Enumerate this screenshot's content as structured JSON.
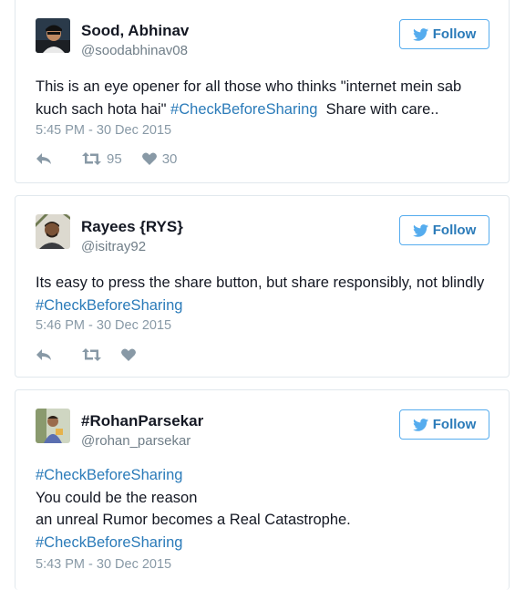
{
  "follow_label": "Follow",
  "colors": {
    "link": "#2b7bb9",
    "follow_border": "#55acee",
    "muted": "#8899a6"
  },
  "icons": {
    "follow": "twitter-bird-icon",
    "reply": "reply-icon",
    "retweet": "retweet-icon",
    "like": "heart-icon"
  },
  "tweets": [
    {
      "name": "Sood, Abhinav",
      "handle": "@soodabhinav08",
      "text_a": "This is an eye opener for all those who thinks \"internet mein sab kuch sach hota hai\" ",
      "hashtag_a": "#CheckBeforeSharing",
      "text_b": "  Share with care..",
      "timestamp": "5:45 PM - 30 Dec 2015",
      "retweets": "95",
      "likes": "30"
    },
    {
      "name": "Rayees {RYS}",
      "handle": "@isitray92",
      "text_a": "Its easy to press the share button, but share responsibly, not blindly ",
      "hashtag_a": "#CheckBeforeSharing",
      "timestamp": "5:46 PM - 30 Dec 2015"
    },
    {
      "name": "#RohanParsekar",
      "handle": "@rohan_parsekar",
      "hashtag_a": "#CheckBeforeSharing",
      "line_1": "You could be the reason",
      "line_2": "an unreal Rumor becomes a Real Catastrophe.",
      "hashtag_b": "#CheckBeforeSharing",
      "timestamp": "5:43 PM - 30 Dec 2015"
    }
  ]
}
